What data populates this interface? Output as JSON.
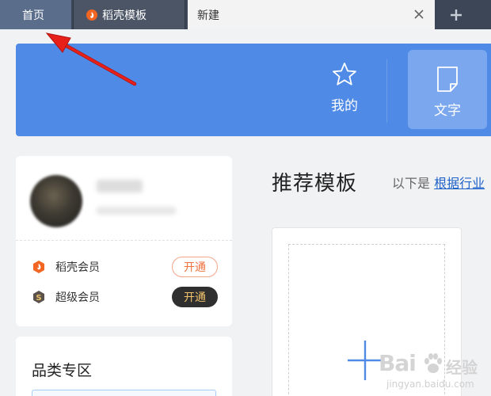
{
  "tabs": {
    "home": "首页",
    "daoke_templates": "稻壳模板",
    "new": "新建"
  },
  "banner": {
    "nav_mine": "我的",
    "nav_text": "文字"
  },
  "user_card": {
    "members": [
      {
        "label": "稻壳会员",
        "button": "开通"
      },
      {
        "label": "超级会员",
        "button": "开通"
      }
    ]
  },
  "category": {
    "title": "品类专区"
  },
  "recommend": {
    "title": "推荐模板",
    "subtitle_prefix": "以下是",
    "subtitle_link": "根据行业"
  },
  "watermark": {
    "brand": "Bai",
    "brand_cn": "经验",
    "url": "jingyan.baidu.com"
  },
  "colors": {
    "tabbar": "#3c4656",
    "banner": "#4e8ae6",
    "accent_orange": "#f0703f",
    "annotation_arrow": "#e8201a"
  }
}
